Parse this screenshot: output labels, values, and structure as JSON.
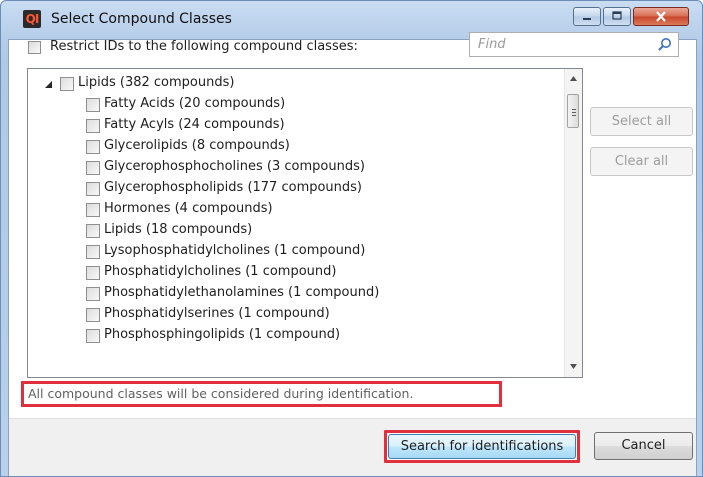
{
  "window": {
    "title": "Select Compound Classes",
    "icon_text": "QI"
  },
  "restrict": {
    "label": "Restrict IDs to the following compound classes:"
  },
  "search": {
    "placeholder": "Find"
  },
  "tree": {
    "root": {
      "label": "Lipids (382 compounds)"
    },
    "children": [
      {
        "label": "Fatty Acids (20 compounds)"
      },
      {
        "label": "Fatty Acyls (24 compounds)"
      },
      {
        "label": "Glycerolipids (8 compounds)"
      },
      {
        "label": "Glycerophosphocholines (3 compounds)"
      },
      {
        "label": "Glycerophospholipids (177 compounds)"
      },
      {
        "label": "Hormones (4 compounds)"
      },
      {
        "label": "Lipids (18 compounds)"
      },
      {
        "label": "Lysophosphatidylcholines (1 compound)"
      },
      {
        "label": "Phosphatidylcholines (1 compound)"
      },
      {
        "label": "Phosphatidylethanolamines (1 compound)"
      },
      {
        "label": "Phosphatidylserines (1 compound)"
      },
      {
        "label": "Phosphosphingolipids (1 compound)"
      }
    ]
  },
  "side_buttons": {
    "select_all": "Select all",
    "clear_all": "Clear all"
  },
  "status": {
    "text": "All compound classes will be considered during identification."
  },
  "footer": {
    "search_label": "Search for identifications",
    "cancel_label": "Cancel"
  },
  "colors": {
    "highlight": "#e0303e",
    "title_gradient": "#b5cde9",
    "close_button": "#c8452a"
  },
  "icons": {
    "search": "search-icon",
    "close": "close-icon",
    "minimize": "minimize-icon",
    "maximize": "maximize-icon",
    "expander": "expanded-triangle-icon"
  }
}
